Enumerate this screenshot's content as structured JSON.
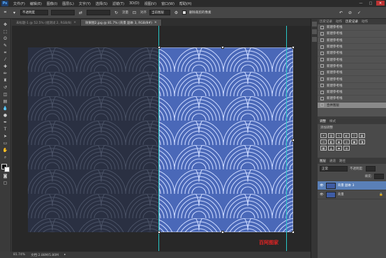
{
  "app": {
    "logo": "Ps"
  },
  "menu": [
    "文件(F)",
    "编辑(E)",
    "图像(I)",
    "图层(L)",
    "文字(Y)",
    "选择(S)",
    "滤镜(T)",
    "3D(D)",
    "视图(V)",
    "窗口(W)",
    "帮助(H)"
  ],
  "window_controls": [
    "—",
    "□",
    "✕"
  ],
  "options": {
    "mode_select": "不透明度",
    "field_a": "",
    "field_b": "",
    "label_a": "流量",
    "label_b": "对齐",
    "sample_select": "当前图层",
    "checkbox_label": "删除裁剪的像素"
  },
  "tabs": [
    {
      "label": "未标题-1 @ 52.5% (组测试 2, RGB/8)",
      "close": "×"
    },
    {
      "label": "效果图2.jpg @ 81.7% (背景 副本 3, RGB/8#)",
      "close": "×"
    }
  ],
  "canvas": {
    "watermark": "百阿图家"
  },
  "status": {
    "zoom": "81.74%",
    "doc": "文档:2.88M/5.80M"
  },
  "history": {
    "tabs": [
      "历史记录",
      "动作",
      "历史记录",
      "动作"
    ],
    "rows": [
      "新建参考线",
      "新建参考线",
      "新建参考线",
      "新建参考线",
      "新建参考线",
      "新建参考线",
      "新建参考线",
      "新建参考线",
      "新建参考线",
      "新建参考线",
      "新建参考线",
      "新建参考线",
      "合并图层"
    ]
  },
  "adjustments": {
    "tabs": [
      "调整",
      "样式"
    ],
    "subtitle": "添加调整"
  },
  "layers": {
    "tabs": [
      "图层",
      "通道",
      "路径"
    ],
    "kind_select": "正常",
    "opacity_label": "不透明度:",
    "fill_label": "填充:",
    "rows": [
      {
        "name": "背景 副本 3"
      },
      {
        "name": "背景"
      }
    ]
  }
}
